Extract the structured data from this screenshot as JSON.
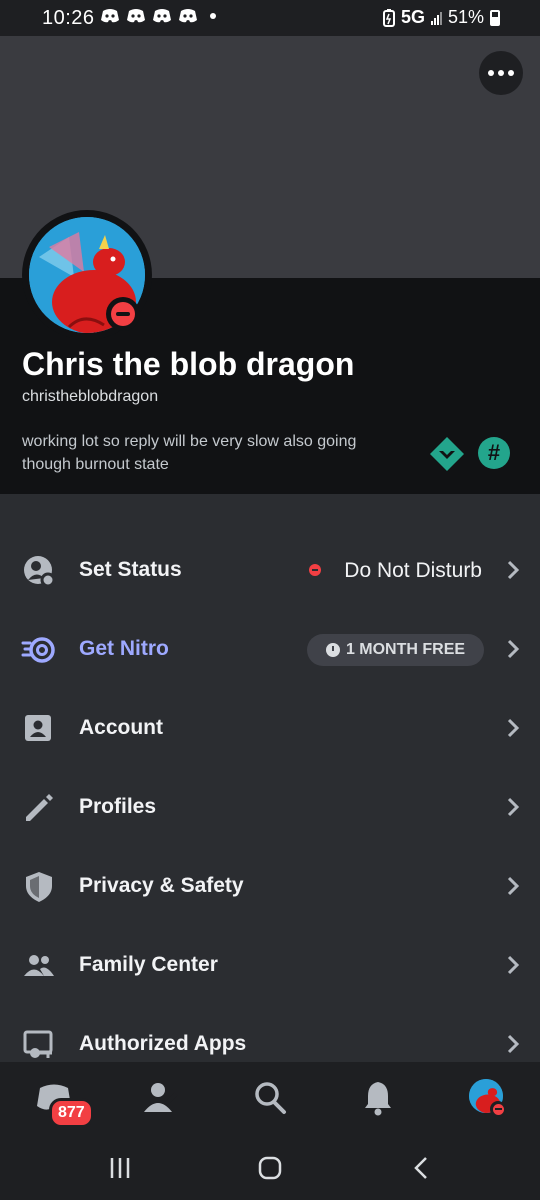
{
  "status_bar": {
    "time": "10:26",
    "network": "5G",
    "battery": "51%"
  },
  "profile": {
    "display_name": "Chris the blob dragon",
    "username": "christheblobdragon",
    "bio": "working lot so reply will be very slow also going though burnout state",
    "status": "dnd",
    "badges": [
      "hypesquad-icon",
      "hashtag-badge-icon"
    ],
    "hash_badge_glyph": "#"
  },
  "menu": {
    "set_status": {
      "label": "Set Status",
      "value": "Do Not Disturb"
    },
    "get_nitro": {
      "label": "Get Nitro",
      "pill": "1 MONTH FREE"
    },
    "account": {
      "label": "Account"
    },
    "profiles": {
      "label": "Profiles"
    },
    "privacy": {
      "label": "Privacy & Safety"
    },
    "family": {
      "label": "Family Center"
    },
    "apps": {
      "label": "Authorized Apps"
    }
  },
  "tabbar": {
    "items": [
      "home-icon",
      "friends-icon",
      "search-icon",
      "notifications-icon",
      "profile-avatar"
    ],
    "home_badge": "877"
  },
  "colors": {
    "background": "#2b2d31",
    "card": "#111214",
    "banner": "#3a3b40",
    "nitro_accent": "#9ea9ff",
    "dnd_red": "#f23f43",
    "badge_teal": "#23a58c"
  }
}
